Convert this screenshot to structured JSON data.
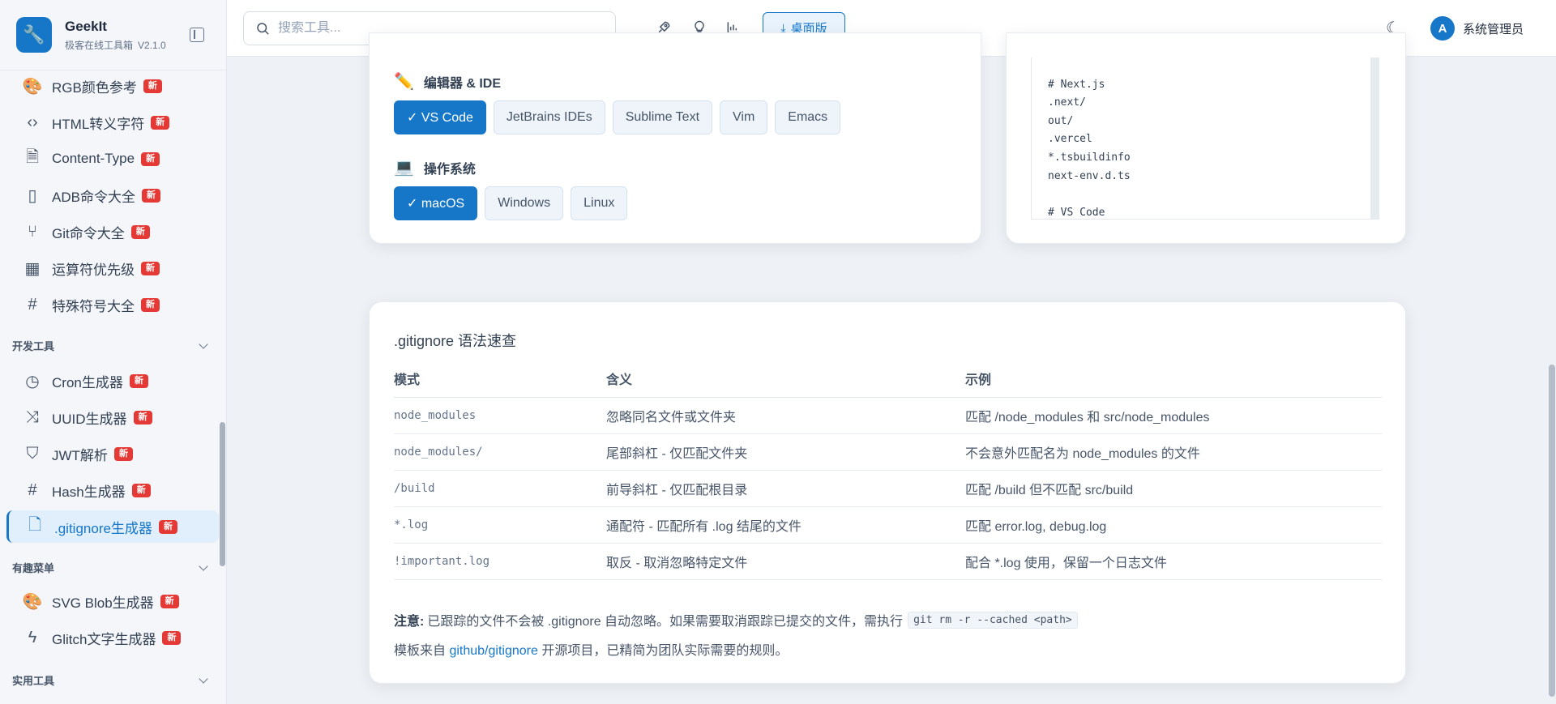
{
  "brand": {
    "name": "GeekIt",
    "subtitle": "极客在线工具箱",
    "version": "V2.1.0"
  },
  "sidebar": {
    "items_top": [
      {
        "label": "RGB颜色参考",
        "icon": "palette-icon",
        "badge": "新"
      },
      {
        "label": "HTML转义字符",
        "icon": "code-brackets-icon",
        "badge": "新"
      },
      {
        "label": "Content-Type",
        "icon": "file-icon",
        "badge": "新"
      },
      {
        "label": "ADB命令大全",
        "icon": "smartphone-icon",
        "badge": "新"
      },
      {
        "label": "Git命令大全",
        "icon": "git-branch-icon",
        "badge": "新"
      },
      {
        "label": "运算符优先级",
        "icon": "calculator-icon",
        "badge": "新"
      },
      {
        "label": "特殊符号大全",
        "icon": "hash-icon",
        "badge": "新"
      }
    ],
    "section_dev": "开发工具",
    "items_dev": [
      {
        "label": "Cron生成器",
        "icon": "clock-icon",
        "badge": "新"
      },
      {
        "label": "UUID生成器",
        "icon": "shuffle-icon",
        "badge": "新"
      },
      {
        "label": "JWT解析",
        "icon": "shield-icon",
        "badge": "新"
      },
      {
        "label": "Hash生成器",
        "icon": "hash-icon",
        "badge": "新"
      },
      {
        "label": ".gitignore生成器",
        "icon": "file-code-icon",
        "badge": "新"
      }
    ],
    "section_fun": "有趣菜单",
    "items_fun": [
      {
        "label": "SVG Blob生成器",
        "icon": "palette-icon",
        "badge": "新"
      },
      {
        "label": "Glitch文字生成器",
        "icon": "zap-icon",
        "badge": "新"
      }
    ],
    "section_util": "实用工具"
  },
  "topbar": {
    "search_placeholder": "搜索工具...",
    "desktop_label": "桌面版",
    "avatar_letter": "A",
    "username": "系统管理员"
  },
  "editor_group": {
    "emoji": "✏️",
    "title": "编辑器 & IDE",
    "chips": [
      {
        "label": "✓ VS Code",
        "selected": true
      },
      {
        "label": "JetBrains IDEs",
        "selected": false
      },
      {
        "label": "Sublime Text",
        "selected": false
      },
      {
        "label": "Vim",
        "selected": false
      },
      {
        "label": "Emacs",
        "selected": false
      }
    ]
  },
  "os_group": {
    "emoji": "💻",
    "title": "操作系统",
    "chips": [
      {
        "label": "✓ macOS",
        "selected": true
      },
      {
        "label": "Windows",
        "selected": false
      },
      {
        "label": "Linux",
        "selected": false
      }
    ]
  },
  "preview_code": "\n# Next.js\n.next/\nout/\n.vercel\n*.tsbuildinfo\nnext-env.d.ts\n\n# VS Code\n.vscode/*",
  "cheatsheet": {
    "title": ".gitignore 语法速查",
    "headers": [
      "模式",
      "含义",
      "示例"
    ],
    "rows": [
      [
        "node_modules",
        "忽略同名文件或文件夹",
        "匹配 /node_modules 和 src/node_modules"
      ],
      [
        "node_modules/",
        "尾部斜杠 - 仅匹配文件夹",
        "不会意外匹配名为 node_modules 的文件"
      ],
      [
        "/build",
        "前导斜杠 - 仅匹配根目录",
        "匹配 /build 但不匹配 src/build"
      ],
      [
        "*.log",
        "通配符 - 匹配所有 .log 结尾的文件",
        "匹配 error.log, debug.log"
      ],
      [
        "!important.log",
        "取反 - 取消忽略特定文件",
        "配合 *.log 使用，保留一个日志文件"
      ]
    ],
    "note_label": "注意:",
    "note_text": "已跟踪的文件不会被 .gitignore 自动忽略。如果需要取消跟踪已提交的文件，需执行",
    "note_code": "git rm -r --cached <path>",
    "source_prefix": "模板来自 ",
    "source_link": "github/gitignore",
    "source_suffix": " 开源项目，已精简为团队实际需要的规则。"
  }
}
